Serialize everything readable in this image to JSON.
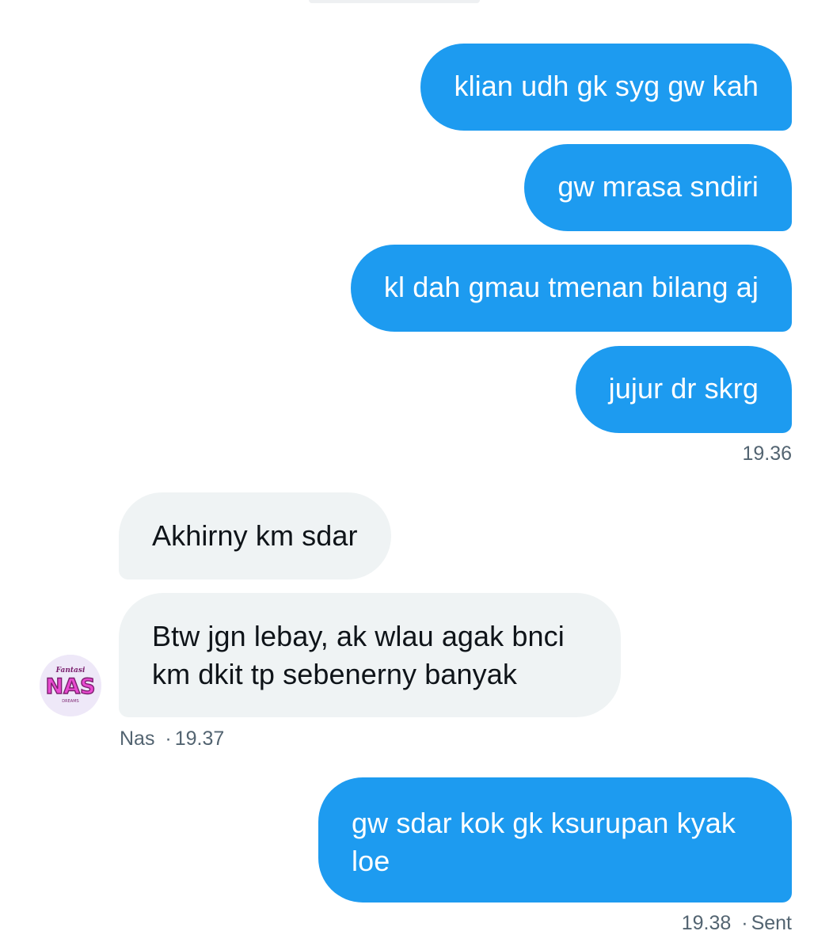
{
  "messages": [
    {
      "text": "klian udh gk syg gw kah"
    },
    {
      "text": "gw mrasa sndiri"
    },
    {
      "text": "kl dah gmau tmenan bilang aj"
    },
    {
      "text": "jujur dr skrg"
    },
    {
      "text": "Akhirny km sdar"
    },
    {
      "text": "Btw jgn lebay, ak wlau agak bnci\nkm dkit tp sebenerny banyak"
    },
    {
      "text": "gw sdar kok gk ksurupan kyak\nloe"
    }
  ],
  "meta": {
    "group1_time": "19.36",
    "sender_name": "Nas",
    "group2_time": "19.37",
    "group3_time": "19.38",
    "status": "Sent",
    "separator": "·"
  },
  "avatar": {
    "logo_text": "NAS",
    "colors": {
      "primary": "#e84ad0",
      "background": "#eee8f8",
      "outline": "#7a1f6e"
    }
  },
  "colors": {
    "outgoing_bubble": "#1d9bf0",
    "incoming_bubble": "#eff3f4",
    "meta_text": "#536471"
  }
}
